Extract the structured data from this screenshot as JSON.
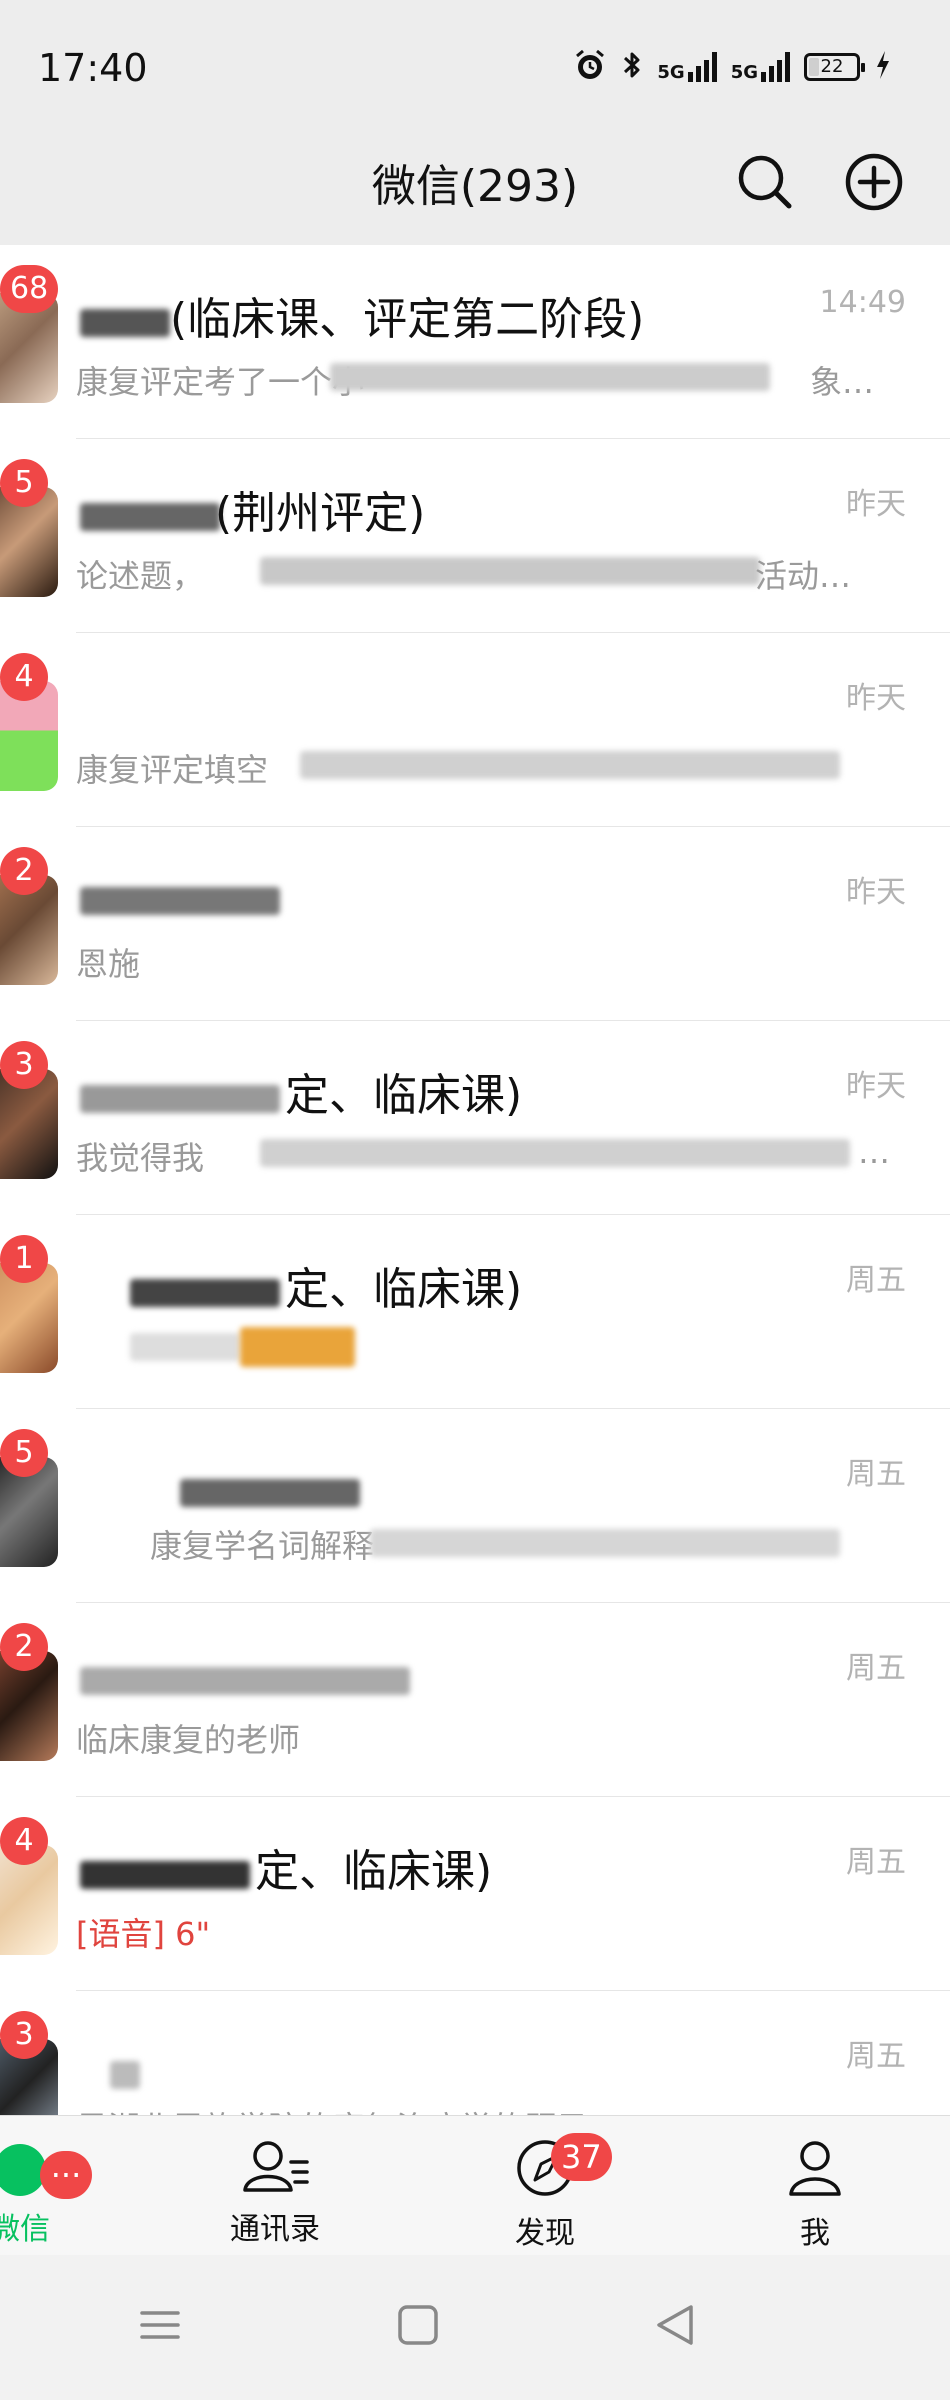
{
  "status_bar": {
    "time": "17:40",
    "battery": "22",
    "signal1": "5G",
    "signal2": "5G",
    "battery_level": 0.22
  },
  "header": {
    "title": "微信(293)",
    "search_icon": "search-icon",
    "add_icon": "plus-circle-icon"
  },
  "chats": [
    {
      "badge": "68",
      "name": "(临床课、评定第二阶段)",
      "preview": "康复评定考了一个小",
      "preview_suffix": "象…",
      "time": "14:49"
    },
    {
      "badge": "5",
      "name": "(荆州评定)",
      "preview": "论述题，",
      "preview_suffix": "活动…",
      "time": "昨天"
    },
    {
      "badge": "4",
      "name": "",
      "preview": "康复评定填空",
      "preview_suffix": "",
      "time": "昨天"
    },
    {
      "badge": "2",
      "name": "",
      "preview": "恩施",
      "preview_suffix": "",
      "time": "昨天"
    },
    {
      "badge": "3",
      "name": "定、临床课)",
      "preview": "我觉得我",
      "preview_suffix": "…",
      "time": "昨天"
    },
    {
      "badge": "1",
      "name": "定、临床课)",
      "preview": "",
      "preview_suffix": "",
      "time": "周五"
    },
    {
      "badge": "5",
      "name": "",
      "preview": "康复学名词解释",
      "preview_suffix": "",
      "time": "周五"
    },
    {
      "badge": "2",
      "name": "",
      "preview": "临床康复的老师",
      "preview_suffix": "",
      "time": "周五"
    },
    {
      "badge": "4",
      "name": "定、临床课)",
      "preview": "[语音] 6\"",
      "preview_suffix": "",
      "time": "周五"
    },
    {
      "badge": "3",
      "name": "",
      "preview": "是湖北恩施学院的康复治疗学的题目",
      "preview_suffix": "",
      "time": "周五"
    }
  ],
  "tabs": [
    {
      "label": "微信",
      "icon": "chat-bubble-icon",
      "badge": "···"
    },
    {
      "label": "通讯录",
      "icon": "contacts-icon",
      "badge": ""
    },
    {
      "label": "发现",
      "icon": "compass-icon",
      "badge": "37"
    },
    {
      "label": "我",
      "icon": "person-icon",
      "badge": ""
    }
  ],
  "colors": {
    "accent": "#07c160",
    "badge": "#f04747",
    "background": "#ededed"
  }
}
